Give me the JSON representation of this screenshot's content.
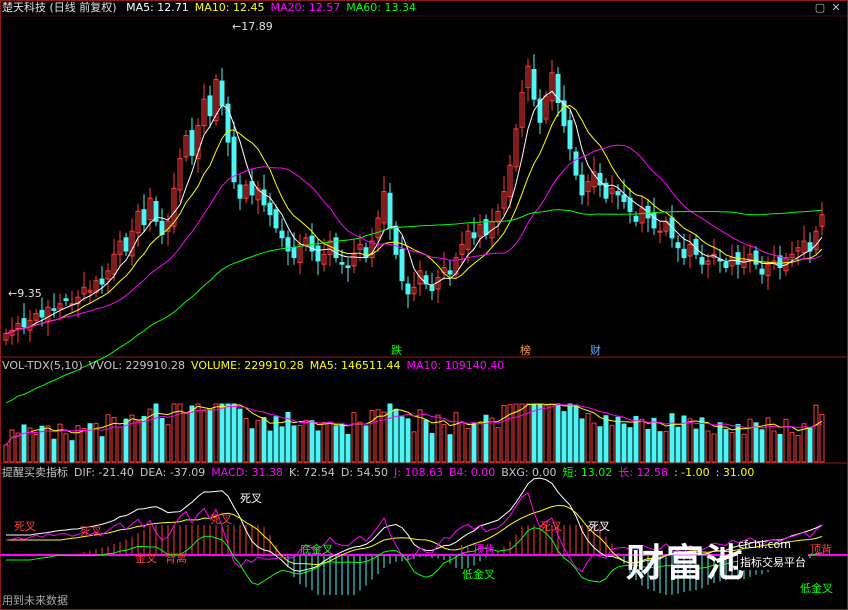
{
  "header": {
    "title": "楚天科技 (日线 前复权)",
    "ma_items": [
      {
        "label": "MA5: 12.71",
        "color": "#ffffff"
      },
      {
        "label": "MA10: 12.45",
        "color": "#ffff00"
      },
      {
        "label": "MA20: 12.57",
        "color": "#ff00ff"
      },
      {
        "label": "MA60: 13.34",
        "color": "#00ff00"
      }
    ]
  },
  "volume_header": {
    "items": [
      {
        "label": "VOL-TDX(5,10)",
        "color": "#c8c8c8"
      },
      {
        "label": "VVOL: 229910.28",
        "color": "#c8c8c8"
      },
      {
        "label": "VOLUME: 229910.28",
        "color": "#ffff00"
      },
      {
        "label": "MA5: 146511.44",
        "color": "#ffff00"
      },
      {
        "label": "MA10: 109140.40",
        "color": "#ff00ff"
      }
    ]
  },
  "indicator_header": {
    "items": [
      {
        "label": "提醒买卖指标",
        "color": "#c8c8c8"
      },
      {
        "label": "DIF: -21.40",
        "color": "#c8c8c8"
      },
      {
        "label": "DEA: -37.09",
        "color": "#c8c8c8"
      },
      {
        "label": "MACD: 31.38",
        "color": "#ff00ff"
      },
      {
        "label": "K: 72.54",
        "color": "#c8c8c8"
      },
      {
        "label": "D: 54.50",
        "color": "#c8c8c8"
      },
      {
        "label": "J: 108.63",
        "color": "#ff00ff"
      },
      {
        "label": "B4: 0.00",
        "color": "#ff00ff"
      },
      {
        "label": "BXG: 0.00",
        "color": "#c8c8c8"
      },
      {
        "label": "短: 13.02",
        "color": "#00ff00"
      },
      {
        "label": "长: 12.58",
        "color": "#ff00ff"
      },
      {
        "label": ": -1.00",
        "color": "#ffff00"
      },
      {
        "label": ": 31.00",
        "color": "#ffff00"
      }
    ]
  },
  "footer": {
    "text": "用到未来数据"
  },
  "brand": {
    "main": "财富池",
    "url": "cfchi.com",
    "tagline": "指标交易平台"
  },
  "colors": {
    "up": "#ff3c3c",
    "down": "#4ff5f5",
    "ma5": "#ffffff",
    "ma10": "#ffff00",
    "ma20": "#ff00ff",
    "ma60": "#00ff00",
    "grid": "#8b1a1a"
  },
  "window_icons": [
    "minimize-icon",
    "close-icon"
  ],
  "chart_data": {
    "type": "candlestick",
    "price_labels": {
      "high": "17.89",
      "low": "9.35"
    },
    "price_range": [
      9.0,
      19.0
    ],
    "events": [
      {
        "label": "跌",
        "color": "#00ff00"
      },
      {
        "label": "榜",
        "color": "#ff9933"
      },
      {
        "label": "财",
        "color": "#66aaff"
      }
    ],
    "signal_labels": [
      {
        "label": "死叉",
        "color": "#ff3c3c"
      },
      {
        "label": "死叉",
        "color": "#ff3c3c"
      },
      {
        "label": "金叉",
        "color": "#ff3c3c"
      },
      {
        "label": "背离",
        "color": "#ff3c3c"
      },
      {
        "label": "死叉",
        "color": "#ffffff"
      },
      {
        "label": "死叉",
        "color": "#ff3c3c"
      },
      {
        "label": "底金叉",
        "color": "#00ff00"
      },
      {
        "label": "LI 顶背",
        "color": "#ff00ff"
      },
      {
        "label": "低金叉",
        "color": "#00ff00"
      },
      {
        "label": "死叉",
        "color": "#ff3c3c"
      },
      {
        "label": "死叉",
        "color": "#ffffff"
      },
      {
        "label": "顶背",
        "color": "#ff3c3c"
      },
      {
        "label": "低金叉",
        "color": "#00ff00"
      }
    ]
  }
}
